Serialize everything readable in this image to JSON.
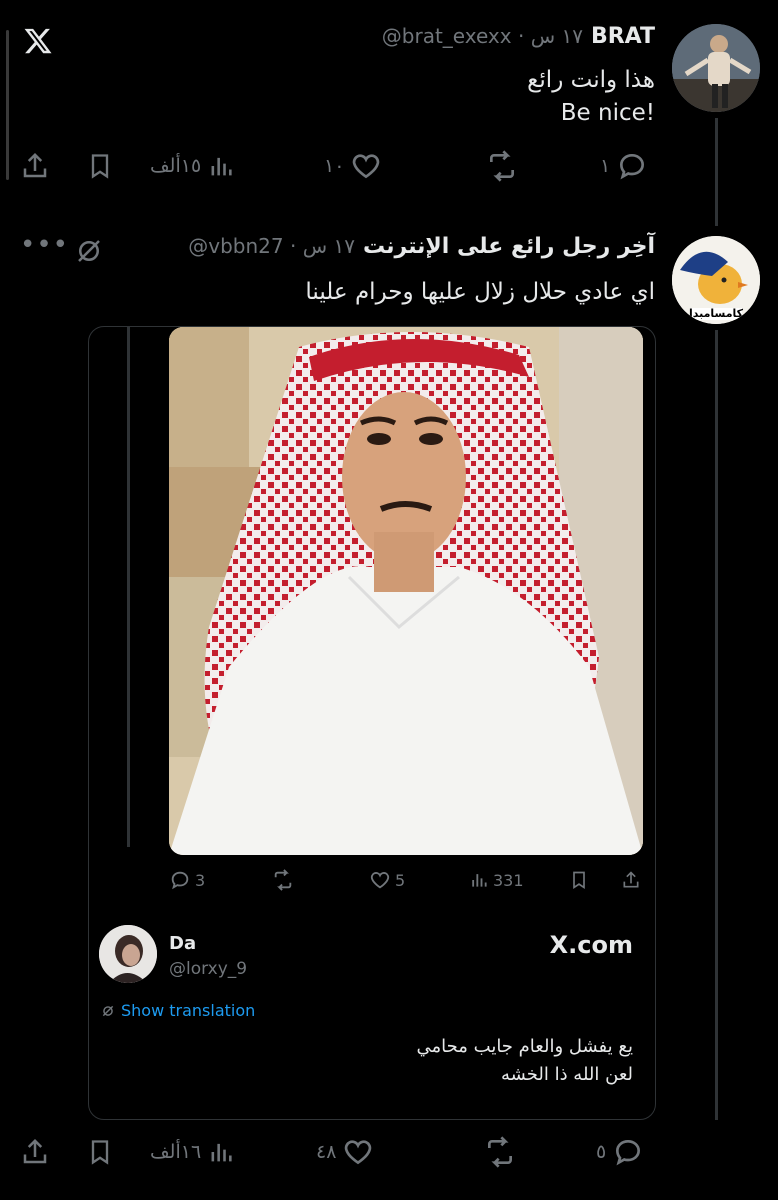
{
  "app": {
    "logo_icon": "x-logo-icon"
  },
  "tweet1": {
    "name": "BRAT",
    "handle": "@brat_exexx",
    "time": "١٧ س",
    "separator": "·",
    "lines": [
      "هذا وانت رائع",
      "Be nice!"
    ],
    "actions": {
      "replies": "١",
      "reposts": "",
      "likes": "١٠",
      "views": "١٥ألف"
    }
  },
  "tweet2": {
    "name": "آخِر رجل رائع على الإنترنت",
    "handle": "@vbbn27",
    "time": "١٧ س",
    "separator": "·",
    "avatar_caption": "كامسامبدا",
    "text": "اي عادي حلال زلال عليها وحرام علينا",
    "embed": {
      "actions": {
        "replies": "3",
        "reposts": "",
        "likes": "5",
        "views": "331"
      },
      "quoted": {
        "name": "Da",
        "handle": "@lorxy_9",
        "source": "X.com",
        "translation_label": "Show translation",
        "lines": [
          "يع يفشل والعام جايب محامي",
          "لعن الله ذا الخشه"
        ]
      }
    },
    "actions": {
      "replies": "٥",
      "reposts": "",
      "likes": "٤٨",
      "views": "١٦ألف"
    }
  },
  "colors": {
    "background": "#000000",
    "text": "#e7e9ea",
    "muted": "#71767b",
    "link": "#1d9bf0",
    "shemagh_red": "#c41e2e"
  }
}
